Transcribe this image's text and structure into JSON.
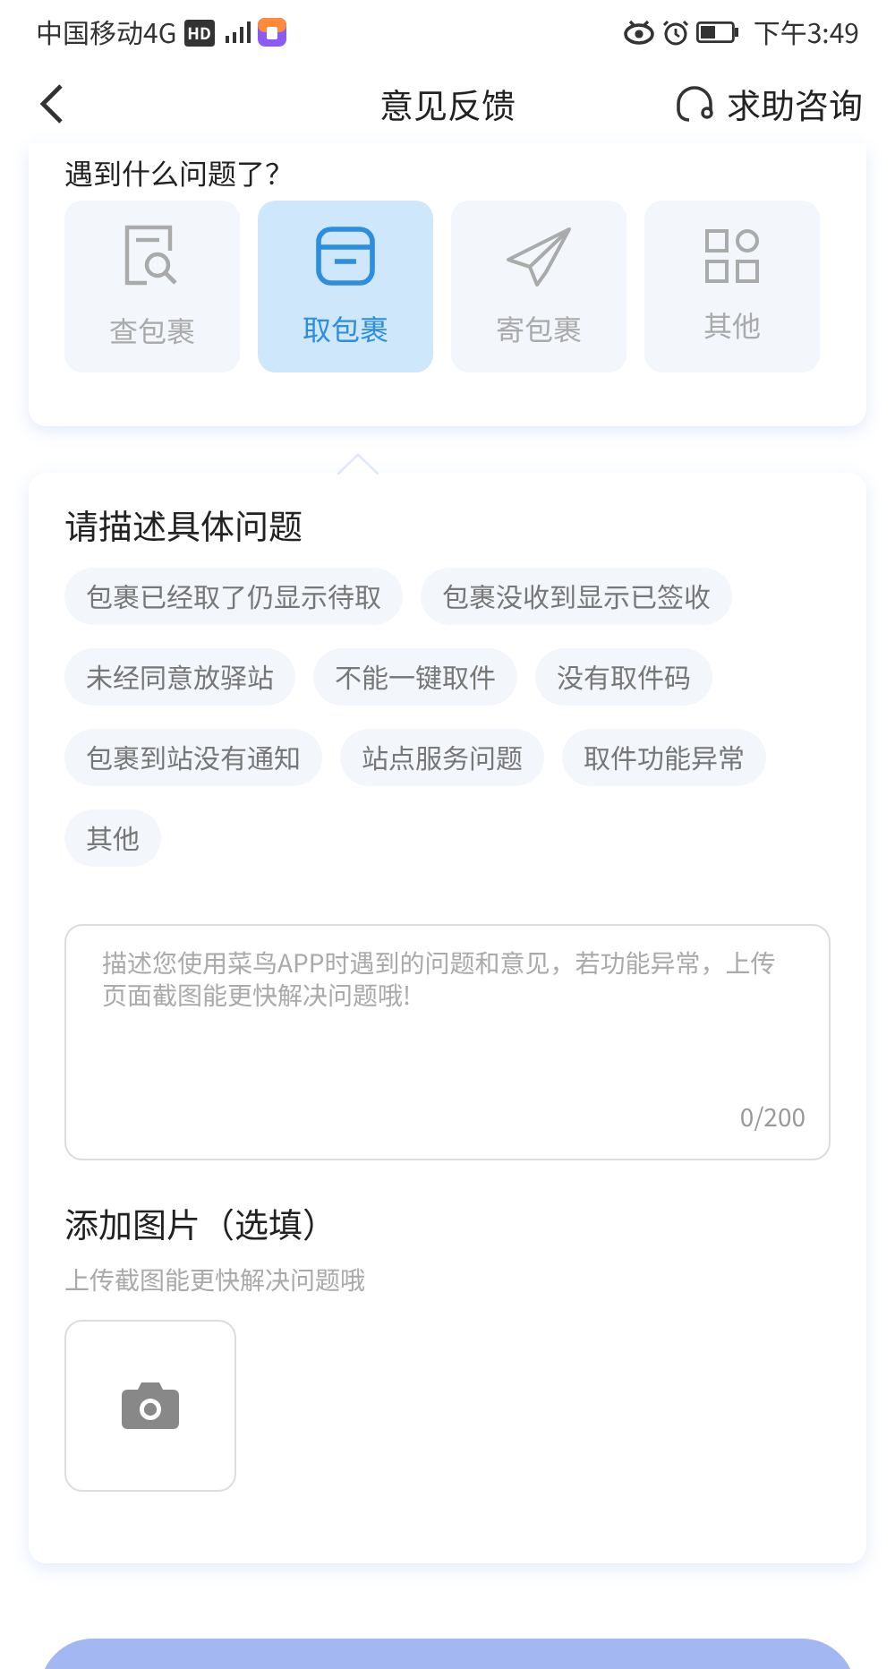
{
  "status_bar": {
    "carrier": "中国移动4G",
    "hd_badge": "HD",
    "time": "下午3:49"
  },
  "nav": {
    "title": "意见反馈",
    "help": "求助咨询"
  },
  "category_card": {
    "heading": "遇到什么问题了？",
    "categories": [
      {
        "label": "查包裹",
        "kind": "search",
        "selected": false
      },
      {
        "label": "取包裹",
        "kind": "box",
        "selected": true
      },
      {
        "label": "寄包裹",
        "kind": "send",
        "selected": false
      },
      {
        "label": "其他",
        "kind": "grid",
        "selected": false
      }
    ]
  },
  "problem_card": {
    "title": "请描述具体问题",
    "tags": [
      {
        "label": "包裹已经取了仍显示待取",
        "selected": false
      },
      {
        "label": "包裹没收到显示已签收",
        "selected": false
      },
      {
        "label": "未经同意放驿站",
        "selected": false
      },
      {
        "label": "不能一键取件",
        "selected": false
      },
      {
        "label": "没有取件码",
        "selected": false
      },
      {
        "label": "包裹到站没有通知",
        "selected": false
      },
      {
        "label": "站点服务问题",
        "selected": false
      },
      {
        "label": "取件功能异常",
        "selected": false
      },
      {
        "label": "其他",
        "selected": false
      }
    ],
    "description": {
      "placeholder": "描述您使用菜鸟APP时遇到的问题和意见，若功能异常，上传页面截图能更快解决问题哦!",
      "counter": "0/200"
    },
    "attachments": {
      "title": "添加图片（选填）",
      "hint": "上传截图能更快解决问题哦"
    }
  }
}
